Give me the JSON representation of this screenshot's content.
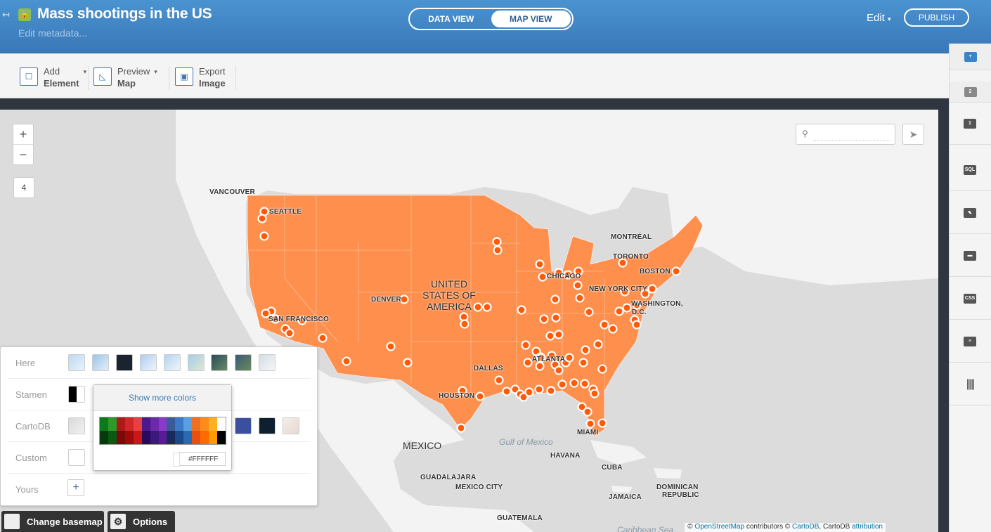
{
  "header": {
    "title": "Mass shootings in the US",
    "metadata_link": "Edit metadata...",
    "views": [
      "DATA VIEW",
      "MAP VIEW"
    ],
    "edit_label": "Edit",
    "publish_label": "PUBLISH"
  },
  "toolbar": {
    "add_element": [
      "Add",
      "Element"
    ],
    "preview_map": [
      "Preview",
      "Map"
    ],
    "export_image": [
      "Export",
      "Image"
    ]
  },
  "sidebar": {
    "layer_tabs": [
      "+",
      "2",
      "1"
    ],
    "tools": [
      "SQL",
      "CSS"
    ]
  },
  "map": {
    "zoom_level": "4",
    "search_placeholder": "",
    "labels": {
      "vancouver": "VANCOUVER",
      "seattle": "SEATTLE",
      "montreal": "MONTRÉAL",
      "toronto": "TORONTO",
      "boston": "BOSTON",
      "chicago": "CHICAGO",
      "newyork": "NEW YORK CITY",
      "washington": "WASHINGTON,",
      "dc": "D.C.",
      "denver": "DENVER",
      "sanfrancisco": "SAN FRANCISCO",
      "dallas": "DALLAS",
      "atlanta": "ATLANTA",
      "houston": "HOUSTON",
      "miami": "MIAMI",
      "havana": "HAVANA",
      "cuba": "CUBA",
      "guadalajara": "GUADALAJARA",
      "mexicocity": "MEXICO CITY",
      "jamaica": "JAMAICA",
      "dominican": "DOMINICAN",
      "republic": "REPUBLIC",
      "guatemala": "GUATEMALA",
      "usa1": "UNITED",
      "usa2": "STATES OF",
      "usa3": "AMERICA",
      "mexico": "MEXICO",
      "gulf": "Gulf of Mexico",
      "caribbean": "Caribbean Sea"
    },
    "attribution": {
      "prefix": "©",
      "osm": "OpenStreetMap",
      "mid": "contributors ©",
      "carto": "CartoDB",
      "mid2": ", CartoDB",
      "attr": "attribution"
    }
  },
  "basemap_panel": {
    "rows": [
      "Here",
      "Stamen",
      "CartoDB",
      "Custom",
      "Yours"
    ],
    "show_more_colors": "Show more colors",
    "hex_value": "#FFFFFF",
    "swatch_colors": [
      [
        "#0a7a1a",
        "#2e9a2a",
        "#b01818",
        "#d02828",
        "#e84040",
        "#4a1a8a",
        "#6a2aaa",
        "#8a3ac8",
        "#3a5a9a",
        "#3a7ac8",
        "#5aa0e0",
        "#f07020",
        "#ff8c1a",
        "#ffb020",
        "#ffffff"
      ],
      [
        "#063a0a",
        "#0a5a12",
        "#7a0a0a",
        "#a00a0a",
        "#c81818",
        "#2a0a5a",
        "#3a1a7a",
        "#5a1a9a",
        "#1a2a5a",
        "#1a4a8a",
        "#2a6ab0",
        "#e85010",
        "#ff6a00",
        "#ff9a00",
        "#000000"
      ]
    ]
  },
  "bottom_buttons": {
    "change_basemap": "Change basemap",
    "options": "Options"
  },
  "colors": {
    "header_blue": "#3f86c6",
    "usa_fill": "#ff8c4a",
    "point_fill": "#ff5a0a"
  }
}
